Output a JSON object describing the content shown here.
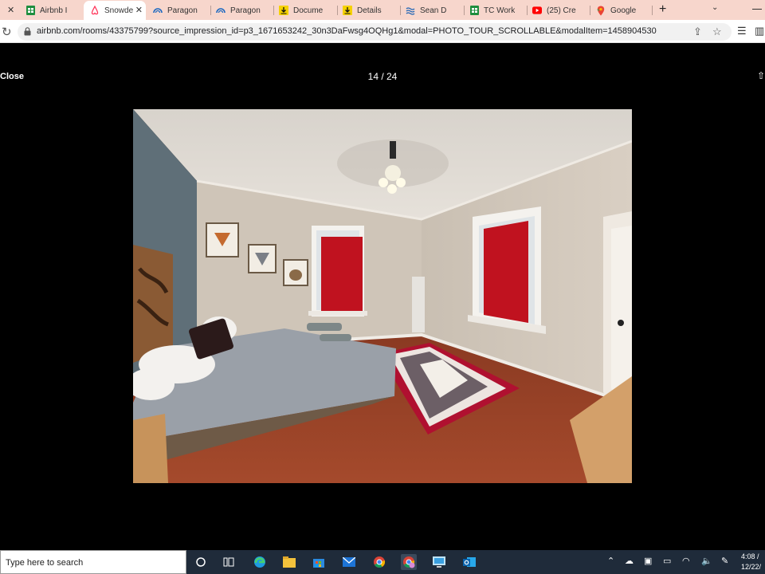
{
  "browser": {
    "tabs": [
      {
        "title": "Airbnb I",
        "icon": "sheets-icon"
      },
      {
        "title": "Snowde",
        "icon": "airbnb-icon",
        "active": true
      },
      {
        "title": "Paragon",
        "icon": "paragon-icon"
      },
      {
        "title": "Paragon",
        "icon": "paragon-icon"
      },
      {
        "title": "Docume",
        "icon": "download-icon"
      },
      {
        "title": "Details",
        "icon": "download-icon"
      },
      {
        "title": "Sean D",
        "icon": "waves-icon"
      },
      {
        "title": "TC Work",
        "icon": "sheets-icon"
      },
      {
        "title": "(25) Cre",
        "icon": "youtube-icon"
      },
      {
        "title": "Google",
        "icon": "maps-icon"
      }
    ],
    "url": "airbnb.com/rooms/43375799?source_impression_id=p3_1671653242_30n3DaFwsg4OQHg1&modal=PHOTO_TOUR_SCROLLABLE&modalItem=1458904530"
  },
  "modal": {
    "close_label": "Close",
    "counter": "14 / 24"
  },
  "taskbar": {
    "search_placeholder": "Type here to search",
    "time": "4:08 /",
    "date": "12/22/"
  },
  "colors": {
    "tab_strip": "#f7d6cc",
    "taskbar": "#1f2b3a",
    "modal_bg": "#000000"
  }
}
